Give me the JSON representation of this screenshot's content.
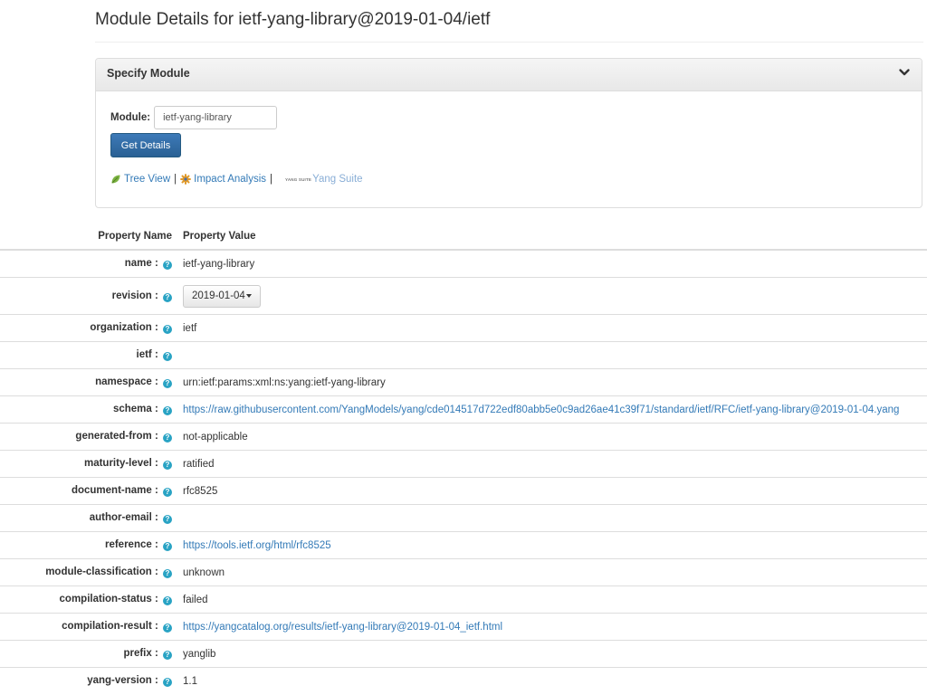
{
  "page": {
    "title": "Module Details for ietf-yang-library@2019-01-04/ietf"
  },
  "panel": {
    "heading": "Specify Module",
    "module_label": "Module:",
    "module_value": "ietf-yang-library",
    "get_details_label": "Get Details",
    "links": {
      "tree_view": "Tree View",
      "separator": "|",
      "impact_analysis": "Impact Analysis",
      "yang_suite_logo": "YANG SUITE",
      "yang_suite": "Yang Suite"
    }
  },
  "table": {
    "headers": {
      "name": "Property Name",
      "value": "Property Value"
    },
    "help_glyph": "?",
    "rows": [
      {
        "name": "name :",
        "value": "ietf-yang-library"
      },
      {
        "name": "revision :",
        "value": "2019-01-04"
      },
      {
        "name": "organization :",
        "value": "ietf"
      },
      {
        "name": "ietf :",
        "value": ""
      },
      {
        "name": "namespace :",
        "value": "urn:ietf:params:xml:ns:yang:ietf-yang-library"
      },
      {
        "name": "schema :",
        "value": "https://raw.githubusercontent.com/YangModels/yang/cde014517d722edf80abb5e0c9ad26ae41c39f71/standard/ietf/RFC/ietf-yang-library@2019-01-04.yang"
      },
      {
        "name": "generated-from :",
        "value": "not-applicable"
      },
      {
        "name": "maturity-level :",
        "value": "ratified"
      },
      {
        "name": "document-name :",
        "value": "rfc8525"
      },
      {
        "name": "author-email :",
        "value": ""
      },
      {
        "name": "reference :",
        "value": "https://tools.ietf.org/html/rfc8525"
      },
      {
        "name": "module-classification :",
        "value": "unknown"
      },
      {
        "name": "compilation-status :",
        "value": "failed"
      },
      {
        "name": "compilation-result :",
        "value": "https://yangcatalog.org/results/ietf-yang-library@2019-01-04_ietf.html"
      },
      {
        "name": "prefix :",
        "value": "yanglib"
      },
      {
        "name": "yang-version :",
        "value": "1.1"
      }
    ]
  },
  "colors": {
    "link": "#337ab7",
    "primary_button": "#2a6194",
    "help_icon": "#29a3c4",
    "tree_icon": "#7cb342",
    "impact_icon": "#e09a2b"
  },
  "icons": {
    "panel_toggle": "chevron-down-icon",
    "tree_view": "leaf-icon",
    "impact_analysis": "gear-icon",
    "help": "question-circle-icon",
    "dropdown": "caret-down-icon"
  }
}
